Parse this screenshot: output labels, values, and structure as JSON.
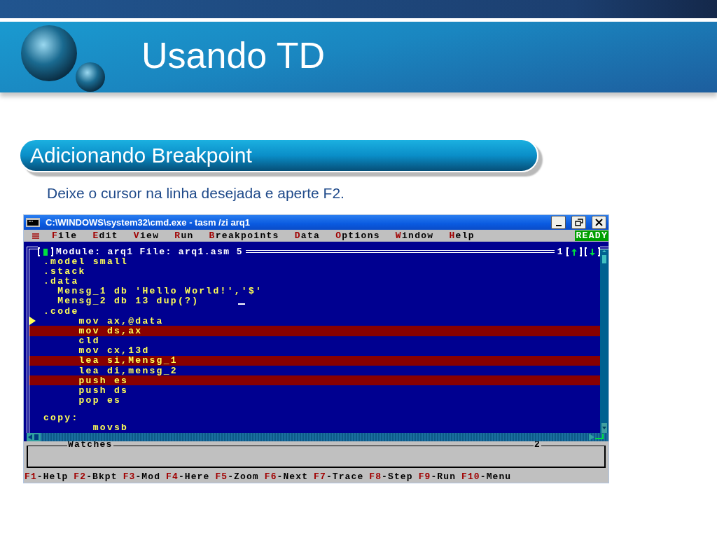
{
  "slide": {
    "title": "Usando TD",
    "section": "Adicionando Breakpoint",
    "instruction": "Deixe o cursor na linha desejada e aperte F2."
  },
  "window": {
    "title": "C:\\WINDOWS\\system32\\cmd.exe - tasm /zi arq1",
    "menu": [
      {
        "key": "F",
        "rest": "ile"
      },
      {
        "key": "E",
        "rest": "dit"
      },
      {
        "key": "V",
        "rest": "iew"
      },
      {
        "key": "R",
        "rest": "un"
      },
      {
        "key": "B",
        "rest": "reakpoints"
      },
      {
        "key": "D",
        "rest": "ata"
      },
      {
        "key": "O",
        "rest": "ptions"
      },
      {
        "key": "W",
        "rest": "indow"
      },
      {
        "key": "H",
        "rest": "elp"
      }
    ],
    "status": "READY",
    "module_title": "Module: arq1 File: arq1.asm 5",
    "pane_number": "1",
    "lines": [
      {
        "kind": "code",
        "text": ".model small",
        "breakpoint": false,
        "current": false,
        "cursor": false
      },
      {
        "kind": "code",
        "text": ".stack",
        "breakpoint": false,
        "current": false,
        "cursor": false
      },
      {
        "kind": "code",
        "text": ".data",
        "breakpoint": false,
        "current": false,
        "cursor": false
      },
      {
        "kind": "code",
        "text": "  Mensg_1 db 'Hello World!','$'",
        "breakpoint": false,
        "current": false,
        "cursor": false
      },
      {
        "kind": "code",
        "text": "  Mensg_2 db 13 dup(?)",
        "breakpoint": false,
        "current": false,
        "cursor": true
      },
      {
        "kind": "code",
        "text": ".code",
        "breakpoint": false,
        "current": false,
        "cursor": false
      },
      {
        "kind": "code",
        "text": "     mov ax,@data",
        "breakpoint": false,
        "current": true,
        "cursor": false
      },
      {
        "kind": "code",
        "text": "     mov ds,ax",
        "breakpoint": true,
        "current": false,
        "cursor": false
      },
      {
        "kind": "code",
        "text": "     cld",
        "breakpoint": false,
        "current": false,
        "cursor": false
      },
      {
        "kind": "code",
        "text": "     mov cx,13d",
        "breakpoint": false,
        "current": false,
        "cursor": false
      },
      {
        "kind": "code",
        "text": "     lea si,Mensg_1",
        "breakpoint": true,
        "current": false,
        "cursor": false
      },
      {
        "kind": "code",
        "text": "     lea di,mensg_2",
        "breakpoint": false,
        "current": false,
        "cursor": false
      },
      {
        "kind": "code",
        "text": "     push es",
        "breakpoint": true,
        "current": false,
        "cursor": false
      },
      {
        "kind": "code",
        "text": "     push ds",
        "breakpoint": false,
        "current": false,
        "cursor": false
      },
      {
        "kind": "code",
        "text": "     pop es",
        "breakpoint": false,
        "current": false,
        "cursor": false
      },
      {
        "kind": "blank"
      },
      {
        "kind": "code",
        "text": "copy:",
        "breakpoint": false,
        "current": false,
        "cursor": false
      },
      {
        "kind": "code",
        "text": "       movsb",
        "breakpoint": false,
        "current": false,
        "cursor": false
      }
    ],
    "watches": {
      "title": "Watches",
      "number": "2"
    },
    "function_keys": [
      {
        "key": "F1",
        "label": "-Help"
      },
      {
        "key": "F2",
        "label": "-Bkpt"
      },
      {
        "key": "F3",
        "label": "-Mod"
      },
      {
        "key": "F4",
        "label": "-Here"
      },
      {
        "key": "F5",
        "label": "-Zoom"
      },
      {
        "key": "F6",
        "label": "-Next"
      },
      {
        "key": "F7",
        "label": "-Trace"
      },
      {
        "key": "F8",
        "label": "-Step"
      },
      {
        "key": "F9",
        "label": "-Run"
      },
      {
        "key": "F10",
        "label": "-Menu"
      }
    ]
  }
}
